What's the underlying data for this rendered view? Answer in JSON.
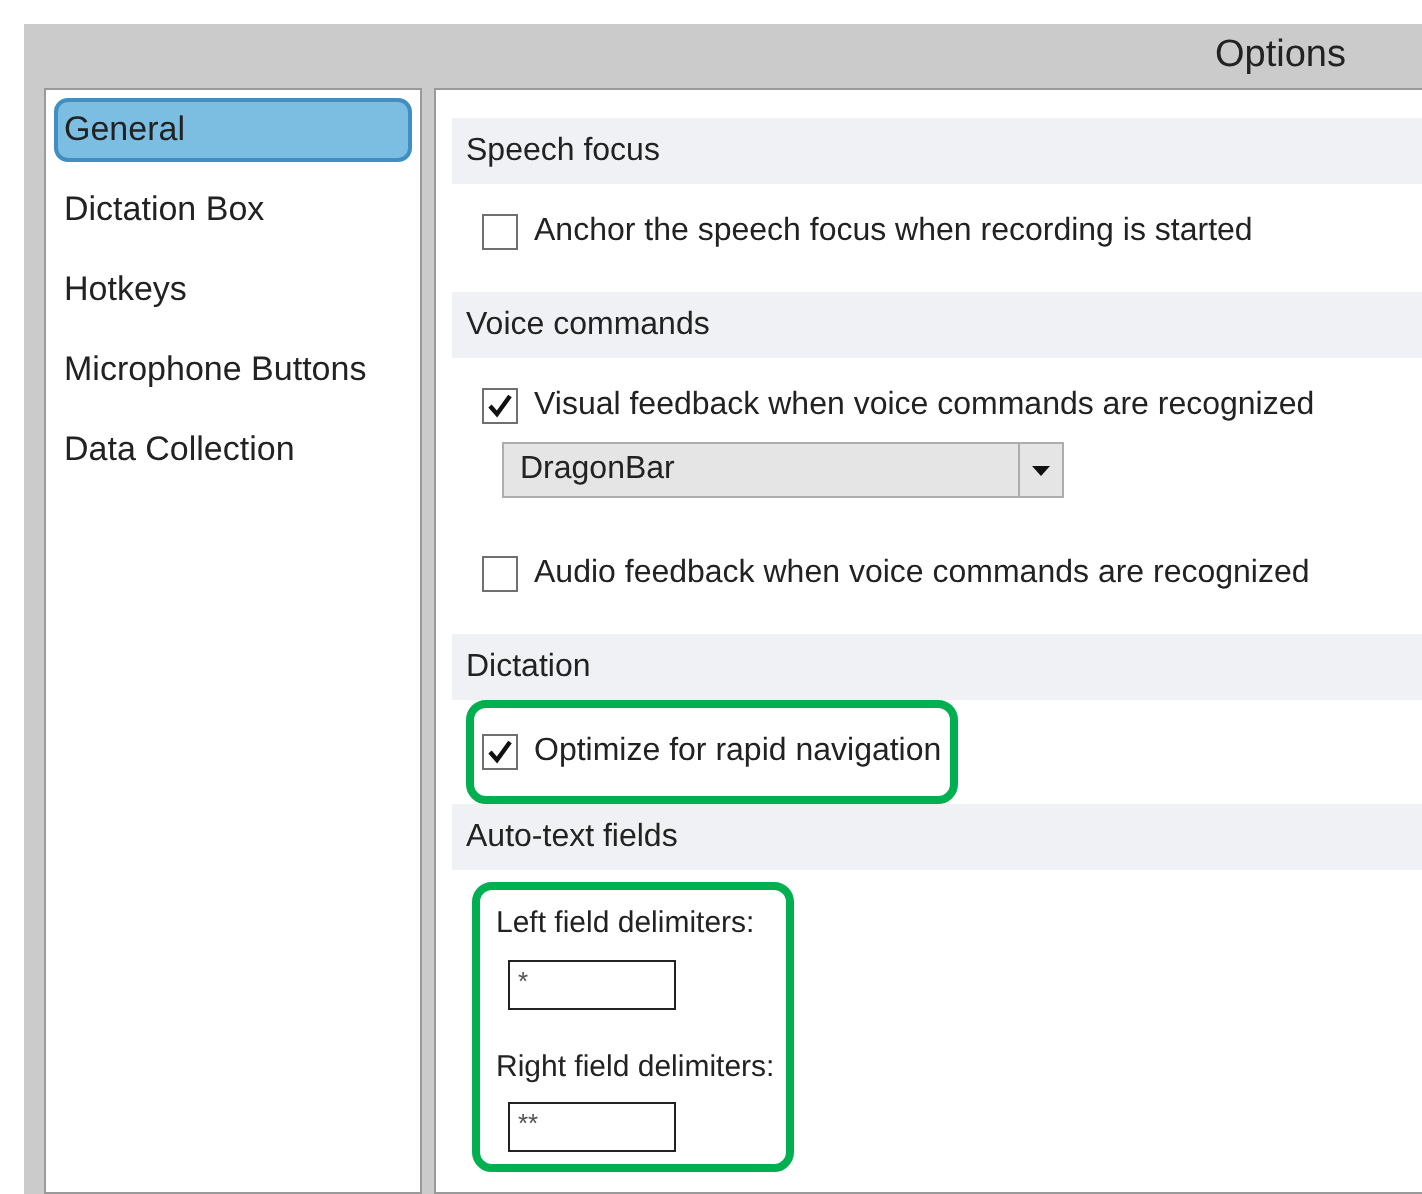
{
  "window": {
    "title": "Options"
  },
  "sidebar": {
    "items": [
      {
        "label": "General",
        "selected": true
      },
      {
        "label": "Dictation Box",
        "selected": false
      },
      {
        "label": "Hotkeys",
        "selected": false
      },
      {
        "label": "Microphone Buttons",
        "selected": false
      },
      {
        "label": "Data Collection",
        "selected": false
      }
    ]
  },
  "sections": [
    {
      "title": "Speech focus",
      "highlighted": false,
      "items": [
        {
          "kind": "checkbox",
          "label": "Anchor the speech focus when recording is started",
          "checked": false
        }
      ]
    },
    {
      "title": "Voice commands",
      "highlighted": false,
      "items": [
        {
          "kind": "checkbox",
          "label": "Visual feedback when voice commands are recognized",
          "checked": true
        },
        {
          "kind": "dropdown",
          "value": "DragonBar"
        },
        {
          "kind": "checkbox",
          "label": "Audio feedback when voice commands are recognized",
          "checked": false
        }
      ]
    },
    {
      "title": "Dictation",
      "highlighted": true,
      "items": [
        {
          "kind": "checkbox",
          "label": "Optimize for rapid navigation",
          "checked": true
        }
      ]
    },
    {
      "title": "Auto-text fields",
      "highlighted": true,
      "items": [
        {
          "kind": "textfield",
          "label": "Left field delimiters:",
          "value": "*"
        },
        {
          "kind": "textfield",
          "label": "Right field delimiters:",
          "value": "**"
        }
      ]
    }
  ]
}
